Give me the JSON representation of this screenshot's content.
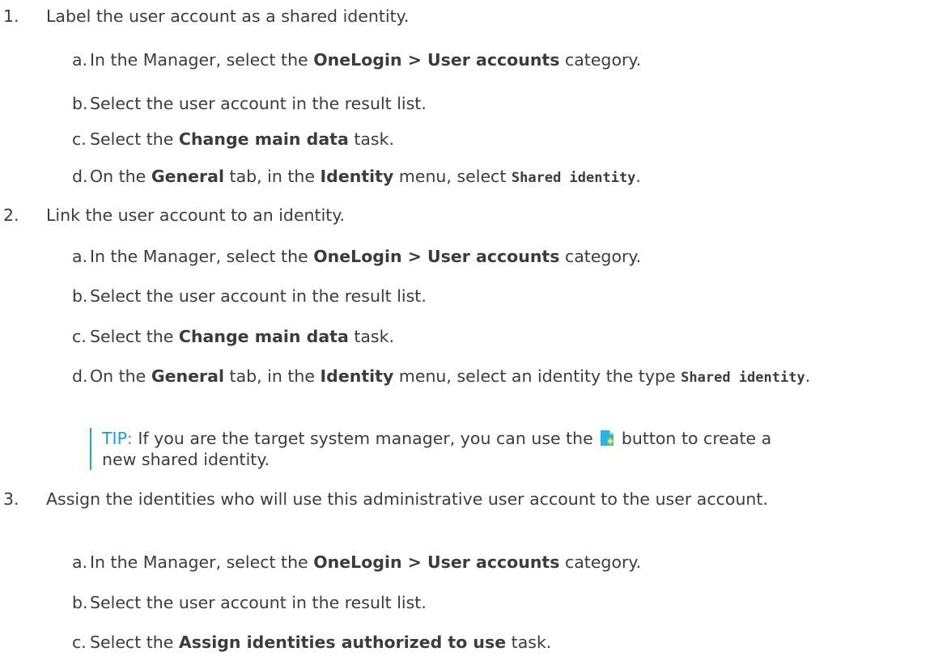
{
  "steps": [
    {
      "num": "1.",
      "text": "Label the user account as a shared identity.",
      "subs": [
        {
          "letter": "a.",
          "pre": "In the Manager, select the ",
          "bold": "OneLogin > User accounts",
          "post": " category."
        },
        {
          "letter": "b.",
          "text": "Select the user account in the result list."
        },
        {
          "letter": "c.",
          "pre": "Select the ",
          "bold": "Change main data",
          "post": " task."
        },
        {
          "letter": "d.",
          "p1": "On the ",
          "b1": "General",
          "p2": " tab, in the ",
          "b2": "Identity",
          "p3": " menu, select ",
          "code": "Shared identity",
          "p4": "."
        }
      ]
    },
    {
      "num": "2.",
      "text": "Link the user account to an identity.",
      "subs": [
        {
          "letter": "a.",
          "pre": "In the Manager, select the ",
          "bold": "OneLogin > User accounts",
          "post": " category."
        },
        {
          "letter": "b.",
          "text": "Select the user account in the result list."
        },
        {
          "letter": "c.",
          "pre": "Select the ",
          "bold": "Change main data",
          "post": " task."
        },
        {
          "letter": "d.",
          "p1": "On the ",
          "b1": "General",
          "p2": " tab, in the ",
          "b2": "Identity",
          "p3": " menu, select an identity the type ",
          "code": "Shared identity",
          "p4": "."
        }
      ],
      "tip": {
        "label": "TIP:",
        "pre": " If you are the target system manager, you can use the ",
        "icon": "add-new-icon",
        "post": " button to create a new shared identity."
      }
    },
    {
      "num": "3.",
      "text": "Assign the identities who will use this administrative user account to the user account.",
      "subs": [
        {
          "letter": "a.",
          "pre": "In the Manager, select the ",
          "bold": "OneLogin > User accounts",
          "post": " category."
        },
        {
          "letter": "b.",
          "text": "Select the user account in the result list."
        },
        {
          "letter": "c.",
          "pre": "Select the ",
          "bold": "Assign identities authorized to use",
          "post": " task."
        }
      ]
    }
  ],
  "colors": {
    "text": "#3c3c3c",
    "tip": "#1aa0d8",
    "tip_border": "#2aa3d6",
    "icon_body": "#2bb3e8",
    "icon_plus": "#7ac143"
  }
}
